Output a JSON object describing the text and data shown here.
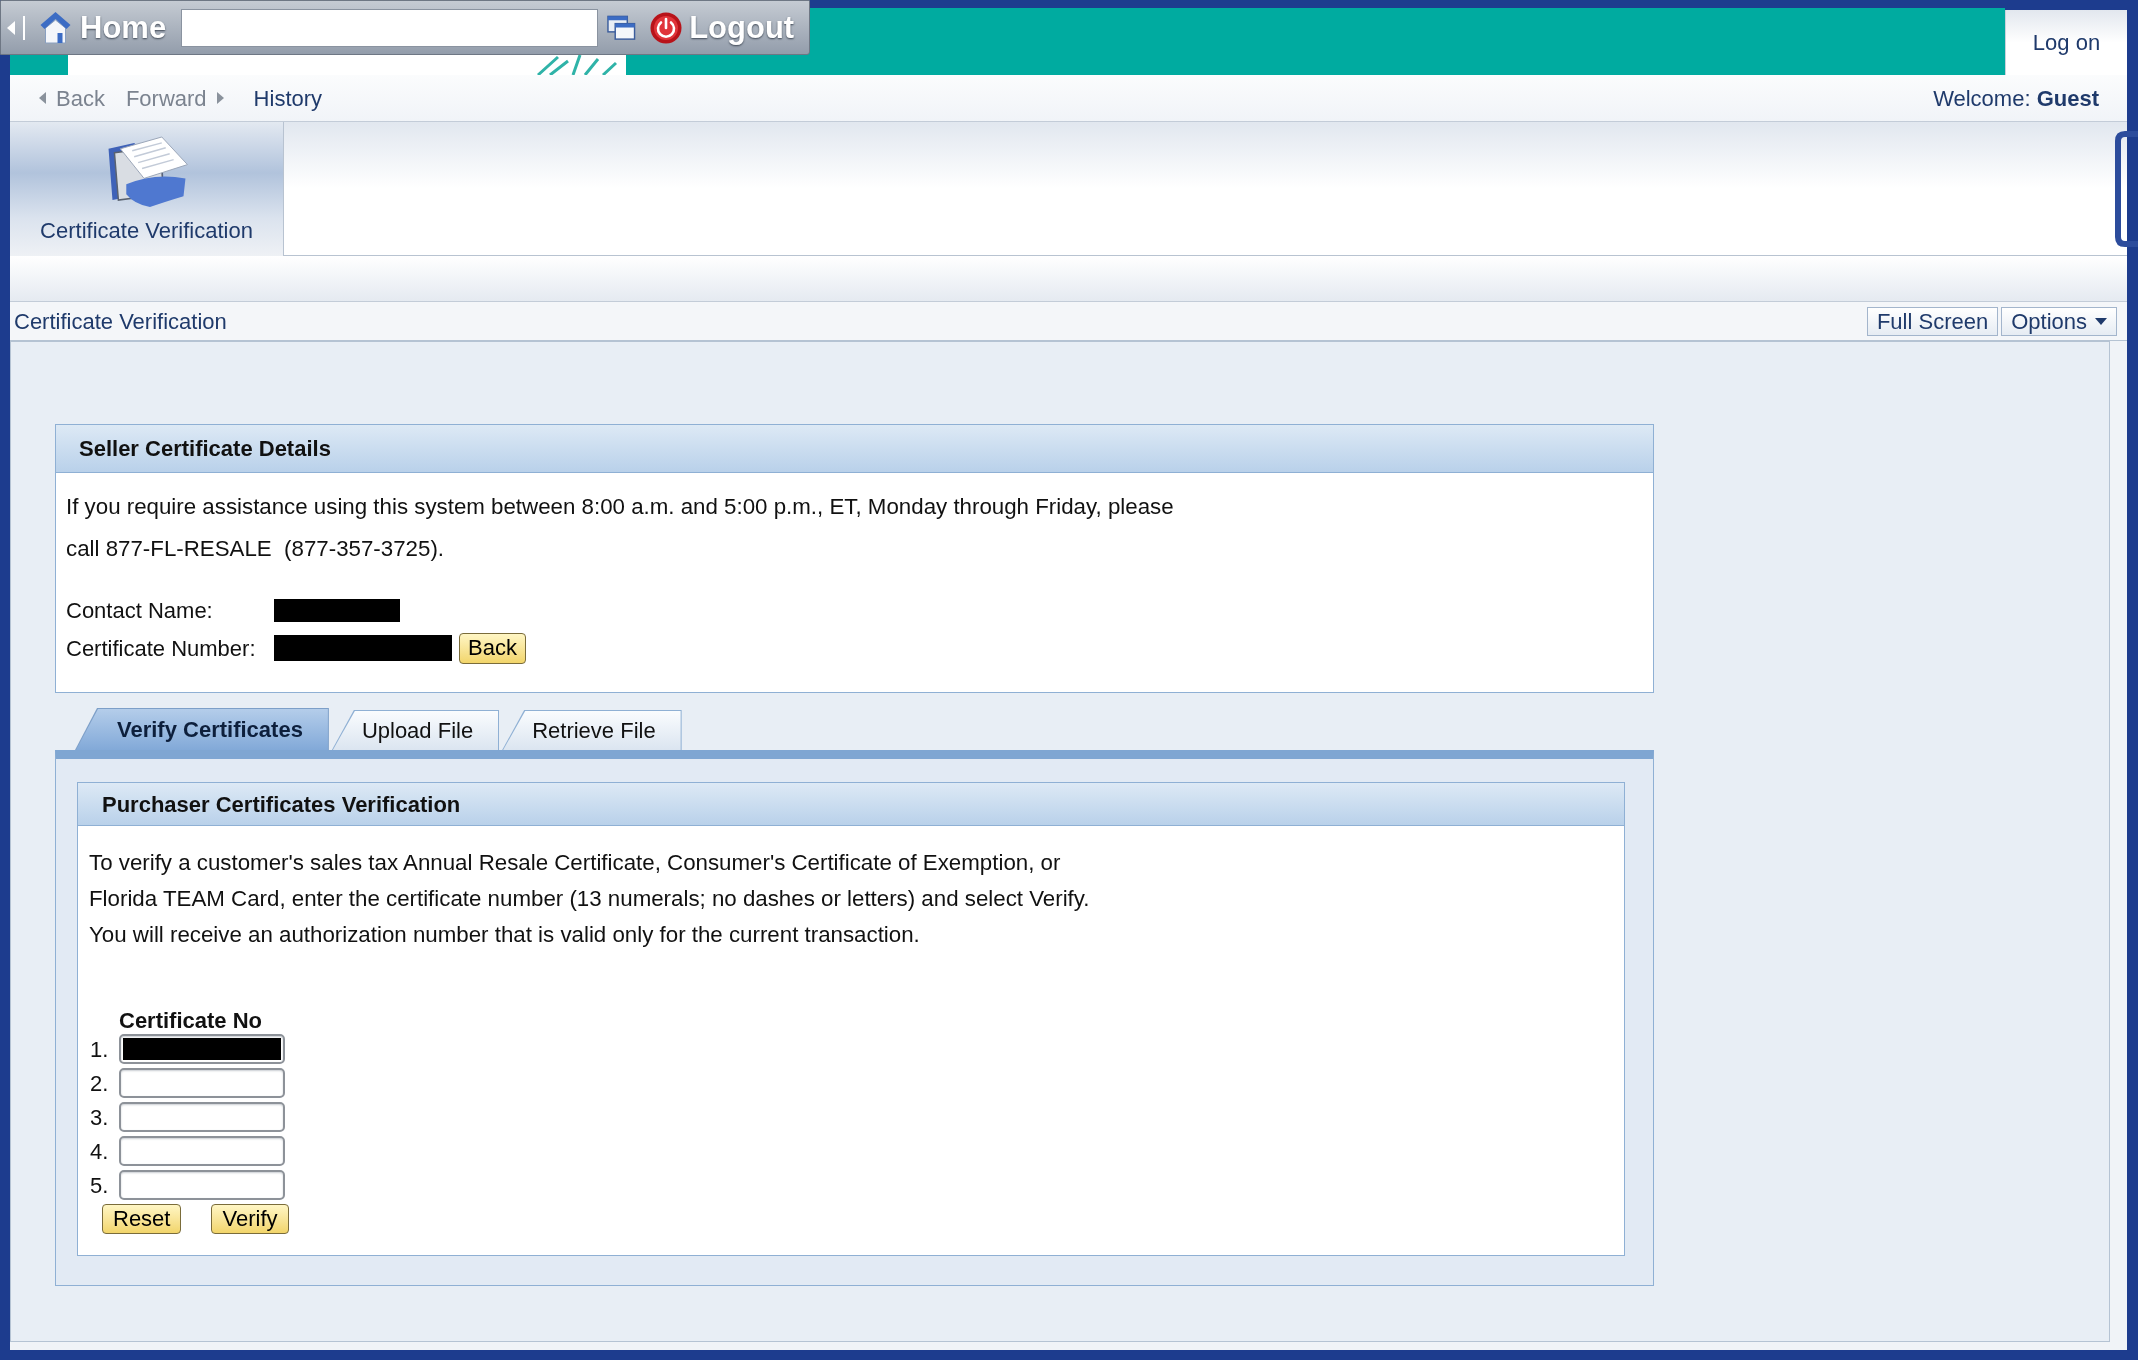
{
  "toolbar": {
    "home": "Home",
    "logout": "Logout"
  },
  "header": {
    "log_on": "Log on"
  },
  "nav": {
    "items": [
      {
        "label": "Back",
        "kind": "back",
        "disabled": true
      },
      {
        "label": "Forward",
        "kind": "forward",
        "disabled": true
      },
      {
        "label": "History",
        "kind": "link",
        "disabled": false
      }
    ],
    "welcome": "Welcome: **Guest**"
  },
  "launchpad": {
    "tiles": [
      {
        "label": "Certificate Verification",
        "selected": true
      }
    ]
  },
  "page_bar": {
    "title": "Certificate Verification",
    "buttons": [
      {
        "label": "Full Screen",
        "kind": "plain"
      },
      {
        "label": "Options",
        "kind": "menu"
      }
    ]
  },
  "seller_panel": {
    "title": "Seller Certificate Details",
    "notice": "If you require assistance using this system between 8:00 a.m. and 5:00 p.m., ET, Monday through Friday, please\ncall 877-FL-RESALE  (877-357-3725).",
    "fields": [
      {
        "label": "Contact Name:",
        "redacted": true
      },
      {
        "label": "Certificate Number:",
        "redacted": true,
        "button": "Back"
      }
    ]
  },
  "tabs": [
    {
      "label": "Verify Certificates",
      "selected": true
    },
    {
      "label": "Upload File",
      "selected": false
    },
    {
      "label": "Retrieve File",
      "selected": false
    }
  ],
  "purchaser_panel": {
    "title": "Purchaser Certificates Verification",
    "instructions": "To verify a customer's sales tax Annual Resale Certificate, Consumer's Certificate of Exemption, or\nFlorida TEAM Card, enter the certificate number (13 numerals; no dashes or letters) and select Verify.\nYou will receive an authorization number that is valid only for the current transaction.",
    "column_header": "Certificate No",
    "rows": [
      {
        "number": "1.",
        "redacted": true
      },
      {
        "number": "2.",
        "redacted": false
      },
      {
        "number": "3.",
        "redacted": false
      },
      {
        "number": "4.",
        "redacted": false
      },
      {
        "number": "5.",
        "redacted": false
      }
    ],
    "buttons": [
      "Reset",
      "Verify"
    ]
  }
}
